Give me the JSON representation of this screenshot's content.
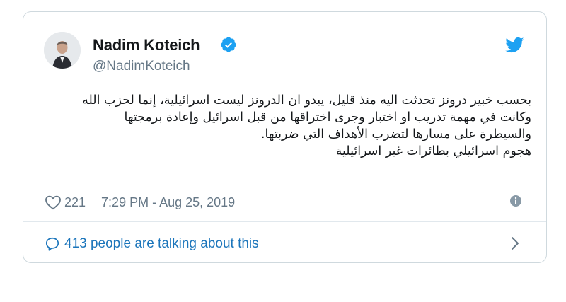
{
  "user": {
    "name": "Nadim Koteich",
    "handle": "@NadimKoteich",
    "verified": true
  },
  "tweet": {
    "lines": [
      "بحسب خبير درونز تحدثت اليه منذ قليل، يبدو ان الدرونز ليست اسرائيلية، إنما لحزب الله",
      "وكانت في مهمة تدريب او اختبار وجرى اختراقها من قبل اسرائيل وإعادة برمجتها",
      "والسيطرة على مسارها لتضرب الأهداف التي ضربتها.",
      "هجوم اسرائيلي بطائرات غير اسرائيلية"
    ]
  },
  "meta": {
    "likes": "221",
    "timestamp": "7:29 PM - Aug 25, 2019"
  },
  "footer": {
    "talking": "413 people are talking about this"
  },
  "colors": {
    "twitter_blue": "#1da1f2",
    "link_blue": "#1b75bb",
    "text": "#14171a",
    "muted": "#657786"
  },
  "icons": {
    "verified": "verified-badge-icon",
    "bird": "twitter-bird-icon",
    "like": "heart-icon",
    "info": "info-icon",
    "reply": "speech-bubble-icon",
    "chevron": "chevron-right-icon"
  }
}
